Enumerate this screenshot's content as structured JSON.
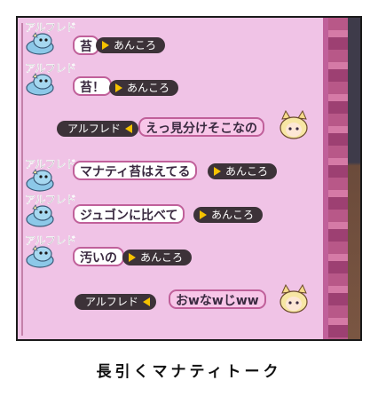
{
  "chat": {
    "messages": [
      {
        "speaker": "アルフレド",
        "text": "苔",
        "recipient": "あんころ"
      },
      {
        "speaker": "アルフレド",
        "text": "苔！",
        "recipient": "あんころ"
      },
      {
        "speaker": "アルフレド",
        "text": "えっ見分けそこなの",
        "recipient": ""
      },
      {
        "speaker": "アルフレド",
        "text": "マナティ苔はえてる",
        "recipient": "あんころ"
      },
      {
        "speaker": "アルフレド",
        "text": "ジュゴンに比べて",
        "recipient": "あんころ"
      },
      {
        "speaker": "アルフレド",
        "text": "汚いの",
        "recipient": "あんころ"
      },
      {
        "speaker": "アルフレド",
        "text": "おwなwじww",
        "recipient": ""
      }
    ]
  },
  "caption": "長引くマナティトーク",
  "colors": {
    "panel": "#f0c3e6",
    "border": "#c0609a",
    "tag": "#3c3238",
    "arrow": "#f5c200"
  },
  "icons": {
    "avatar_left": "blue-dragon-avatar-icon",
    "avatar_right": "blonde-cat-girl-avatar-icon"
  }
}
